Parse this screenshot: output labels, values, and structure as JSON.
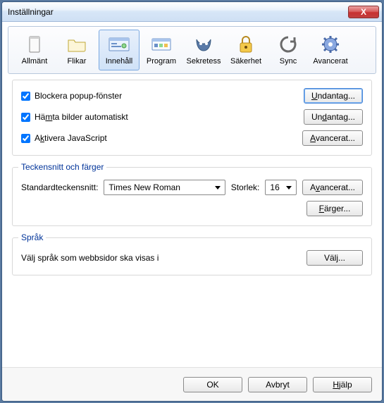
{
  "window": {
    "title": "Inställningar",
    "close": "X"
  },
  "tabs": {
    "general": "Allmänt",
    "tabs": "Flikar",
    "content": "Innehåll",
    "apps": "Program",
    "privacy": "Sekretess",
    "security": "Säkerhet",
    "sync": "Sync",
    "advanced": "Avancerat"
  },
  "content": {
    "block_popups": "Blockera popup-fönster",
    "load_images": "Hämta bilder automatiskt",
    "enable_js": "Aktivera JavaScript",
    "exceptions": "Undantag...",
    "advanced": "Avancerat..."
  },
  "fonts": {
    "title": "Teckensnitt och färger",
    "default_font_label": "Standardteckensnitt:",
    "font_value": "Times New Roman",
    "size_label": "Storlek:",
    "size_value": "16",
    "advanced": "Avancerat...",
    "colors": "Färger..."
  },
  "lang": {
    "title": "Språk",
    "desc": "Välj språk som webbsidor ska visas i",
    "choose": "Välj..."
  },
  "footer": {
    "ok": "OK",
    "cancel": "Avbryt",
    "help": "Hjälp"
  }
}
